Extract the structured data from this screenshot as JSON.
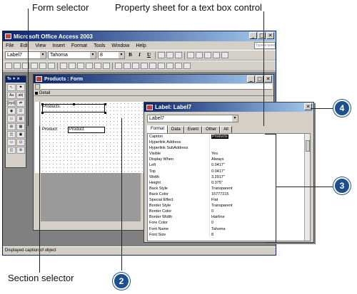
{
  "callouts": {
    "form_selector": "Form selector",
    "property_sheet": "Property sheet for a text box control",
    "section_selector": "Section selector",
    "badges": [
      "2",
      "3",
      "4"
    ]
  },
  "access": {
    "title": "Microsoft Office Access 2003",
    "menu": [
      "File",
      "Edit",
      "View",
      "Insert",
      "Format",
      "Tools",
      "Window",
      "Help"
    ],
    "help_placeholder": "Type a question for help",
    "object_combo": "Label7",
    "font_combo": "Tahoma",
    "size_combo": "8",
    "bold": "B",
    "italic": "I",
    "underline": "U",
    "status": "Displayed caption of object",
    "toolbox_title": "To ▼ ✕",
    "toolbox_tools": [
      "↖",
      "⚑",
      "Aa",
      "ab|",
      "[xyz]",
      "⇄",
      "◉",
      "☑",
      "▭",
      "▤",
      "⊞",
      "▦",
      "◫",
      "▣",
      "▭",
      "⊡",
      "◱",
      "⚙"
    ]
  },
  "form": {
    "title": "Products : Form",
    "section": "Detail",
    "label_caption": "Products",
    "field_label": "Product:",
    "field_value": "Product"
  },
  "property_sheet": {
    "title": "Label: Label7",
    "selector": "Label7",
    "tabs": [
      "Format",
      "Data",
      "Event",
      "Other",
      "All"
    ],
    "rows": [
      {
        "name": "Caption",
        "value": "Products"
      },
      {
        "name": "Hyperlink Address",
        "value": ""
      },
      {
        "name": "Hyperlink SubAddress",
        "value": ""
      },
      {
        "name": "Visible",
        "value": "Yes"
      },
      {
        "name": "Display When",
        "value": "Always"
      },
      {
        "name": "Left",
        "value": "0.0417\""
      },
      {
        "name": "Top",
        "value": "0.0417\""
      },
      {
        "name": "Width",
        "value": "3.2917\""
      },
      {
        "name": "Height",
        "value": "0.375\""
      },
      {
        "name": "Back Style",
        "value": "Transparent"
      },
      {
        "name": "Back Color",
        "value": "16777215"
      },
      {
        "name": "Special Effect",
        "value": "Flat"
      },
      {
        "name": "Border Style",
        "value": "Transparent"
      },
      {
        "name": "Border Color",
        "value": "0"
      },
      {
        "name": "Border Width",
        "value": "Hairline"
      },
      {
        "name": "Fore Color",
        "value": "0"
      },
      {
        "name": "Font Name",
        "value": "Tahoma"
      },
      {
        "name": "Font Size",
        "value": "8"
      }
    ]
  },
  "colors": {
    "title_active": "#0a246a",
    "badge": "#1d4f8f",
    "chrome": "#d4d0c8"
  }
}
